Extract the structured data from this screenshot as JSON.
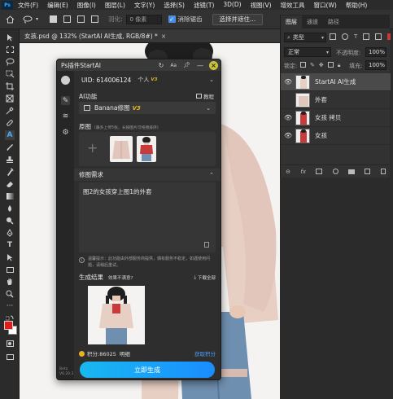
{
  "menubar": {
    "items": [
      "文件(F)",
      "编辑(E)",
      "图像(I)",
      "图层(L)",
      "文字(Y)",
      "选择(S)",
      "滤镜(T)",
      "3D(D)",
      "视图(V)",
      "增效工具",
      "窗口(W)",
      "帮助(H)"
    ]
  },
  "options": {
    "feather_label": "羽化:",
    "feather_value": "0 像素",
    "antialias_label": "消除锯齿",
    "select_subject_label": "选择并遮住..."
  },
  "document": {
    "tab_title": "女孩.psd @ 132% (StartAI AI生成, RGB/8#) *",
    "close_glyph": "×"
  },
  "layers_panel": {
    "tabs": [
      "图层",
      "通道",
      "路径"
    ],
    "kind_label": "类型",
    "blend_mode": "正常",
    "opacity_label": "不透明度:",
    "opacity_value": "100%",
    "lock_label": "锁定:",
    "fill_label": "填充:",
    "fill_value": "100%",
    "layers": [
      {
        "name": "StartAI AI生成",
        "visible": true,
        "selected": true
      },
      {
        "name": "外套",
        "visible": false,
        "selected": false
      },
      {
        "name": "女孩 拷贝",
        "visible": true,
        "selected": false
      },
      {
        "name": "女孩",
        "visible": true,
        "selected": false
      }
    ],
    "footer_icons": [
      "link-icon",
      "fx-icon",
      "mask-icon",
      "adjustment-icon",
      "folder-icon",
      "new-layer-icon",
      "trash-icon"
    ],
    "footer_fx": "fx"
  },
  "plugin": {
    "title": "Ps插件StartAI",
    "uid_text": "UID: 614006124",
    "account_type": "个人",
    "account_badge": "V3",
    "ai_function_label": "AI功能",
    "tutorial_label": "教程",
    "model_name": "Banana修图",
    "model_version": "V3",
    "original_label": "原图",
    "original_hint": "(最多上传5张，长按图片可拖拽排序)",
    "add_glyph": "+",
    "requirement_header": "修图需求",
    "prompt_text": "图2的女孩穿上图1的外套",
    "notice_text": "温馨提示：此功能由外部服务商提供，偶有服务不稳定，如遇使用问题，请稍后重试。",
    "result_label": "生成结果",
    "result_unsatisfied": "效果不满意?",
    "download_all": "下载全部",
    "points_text": "积分:86025",
    "points_suffix": "明细",
    "get_points": "获取积分",
    "generate_button": "立即生成",
    "side_footer": "Beta\nV6.20.3",
    "colors": {
      "accent_gradient_start": "#19b8f0",
      "accent_gradient_end": "#1a8dff",
      "gold": "#e6b422",
      "link_blue": "#4a9eff"
    }
  },
  "toolbar": {
    "icons": [
      "move-icon",
      "marquee-icon",
      "lasso-icon",
      "object-select-icon",
      "crop-icon",
      "frame-icon",
      "eyedropper-icon",
      "heal-icon",
      "ai-tool-icon",
      "brush-icon",
      "stamp-icon",
      "history-brush-icon",
      "eraser-icon",
      "gradient-icon",
      "blur-icon",
      "dodge-icon",
      "pen-icon",
      "text-icon",
      "path-select-icon",
      "rectangle-icon",
      "hand-icon",
      "zoom-icon",
      "more-tools-icon",
      "color-swatch",
      "quick-mask-icon",
      "screen-mode-icon"
    ],
    "text_tool_glyph": "T"
  }
}
